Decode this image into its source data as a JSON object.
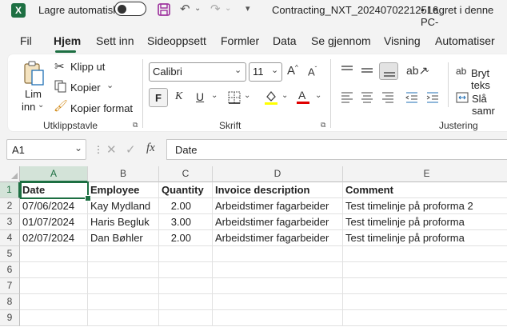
{
  "titlebar": {
    "autosave_label": "Lagre automatisk",
    "file_title": "Contracting_NXT_20240702212516",
    "saved_status": "• Lagret i denne PC-"
  },
  "menu": [
    "Fil",
    "Hjem",
    "Sett inn",
    "Sideoppsett",
    "Formler",
    "Data",
    "Se gjennom",
    "Visning",
    "Automatiser"
  ],
  "ribbon": {
    "clipboard": {
      "paste_line1": "Lim",
      "paste_line2": "inn",
      "cut": "Klipp ut",
      "copy": "Kopier",
      "format_painter": "Kopier format",
      "group_label": "Utklippstavle"
    },
    "font": {
      "font_name": "Calibri",
      "font_size": "11",
      "bold": "F",
      "italic": "K",
      "underline": "U",
      "group_label": "Skrift",
      "fill_color": "#ffff00",
      "font_color": "#e00000"
    },
    "alignment": {
      "wrap_text": "Bryt teks",
      "merge": "Slå samr",
      "group_label": "Justering"
    }
  },
  "formula_bar": {
    "name_box": "A1",
    "fx": "fx",
    "content": "Date"
  },
  "sheet": {
    "columns": [
      "A",
      "B",
      "C",
      "D",
      "E"
    ],
    "rows": [
      "1",
      "2",
      "3",
      "4",
      "5",
      "6",
      "7",
      "8",
      "9"
    ],
    "header": [
      "Date",
      "Employee",
      "Quantity",
      "Invoice description",
      "Comment"
    ],
    "data": [
      [
        "07/06/2024",
        "Kay Mydland",
        "2.00",
        "Arbeidstimer fagarbeider",
        "Test timelinje på proforma 2"
      ],
      [
        "01/07/2024",
        "Haris Begluk",
        "3.00",
        "Arbeidstimer fagarbeider",
        "Test timelinje på proforma"
      ],
      [
        "02/07/2024",
        "Dan Bøhler",
        "2.00",
        "Arbeidstimer fagarbeider",
        "Test timelinje på proforma"
      ]
    ]
  },
  "colors": {
    "accent": "#1d6f42"
  }
}
